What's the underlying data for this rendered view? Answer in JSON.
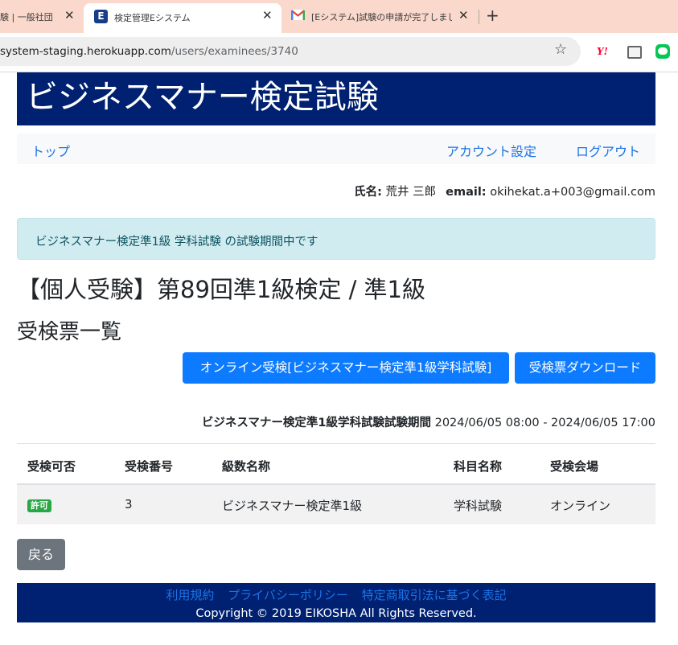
{
  "browser": {
    "tabs": [
      {
        "title": "験 | 一般社団",
        "active": false
      },
      {
        "title": "検定管理Eシステム",
        "active": true
      },
      {
        "title": "[Eシステム]試験の申請が完了しまし",
        "active": false
      }
    ],
    "new_tab": "+",
    "url_host": "system-staging.herokuapp.com",
    "url_path": "/users/examinees/3740"
  },
  "header": {
    "title": "ビジネスマナー検定試験"
  },
  "nav": {
    "top": "トップ",
    "account": "アカウント設定",
    "logout": "ログアウト"
  },
  "user": {
    "name_label": "氏名:",
    "name": "荒井 三郎",
    "email_label": "email:",
    "email": "okihekat.a+003@gmail.com"
  },
  "alert": {
    "text": "ビジネスマナー検定準1級 学科試験 の試験期間中です"
  },
  "exam_heading": "【個人受験】第89回準1級検定 / 準1級",
  "list_heading": "受検票一覧",
  "buttons": {
    "online": "オンライン受検[ビジネスマナー検定準1級学科試験]",
    "download": "受検票ダウンロード",
    "back": "戻る"
  },
  "period": {
    "label": "ビジネスマナー検定準1級学科試験試験期間",
    "value": "2024/06/05 08:00 - 2024/06/05 17:00"
  },
  "table": {
    "headers": [
      "受検可否",
      "受検番号",
      "級数名称",
      "科目名称",
      "受検会場"
    ],
    "rows": [
      {
        "status": "許可",
        "number": "3",
        "grade": "ビジネスマナー検定準1級",
        "subject": "学科試験",
        "venue": "オンライン"
      }
    ]
  },
  "footer": {
    "links": [
      "利用規約",
      "プライバシーポリシー",
      "特定商取引法に基づく表記"
    ],
    "copyright": "Copyright © 2019 EIKOSHA All Rights Reserved."
  },
  "colors": {
    "header_bg": "#002171",
    "primary": "#0d7bff",
    "link": "#1a73e8",
    "success": "#28a745",
    "alert_bg": "#d1ecf1",
    "secondary": "#6c757d"
  }
}
